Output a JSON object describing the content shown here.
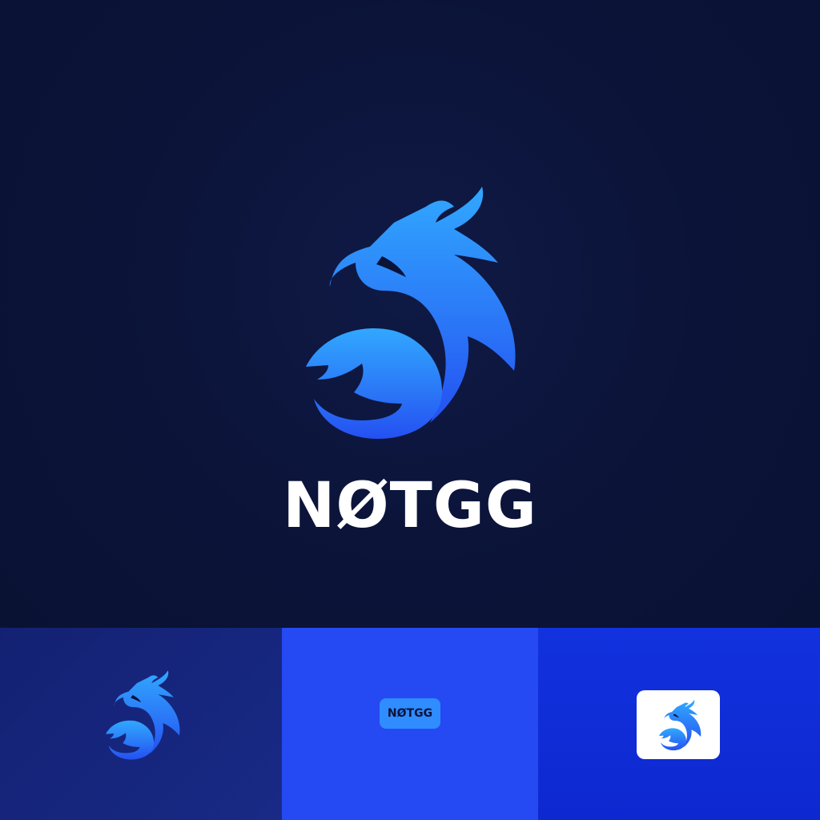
{
  "brand": {
    "wordmark": "NØTGG",
    "small_wordmark": "NØTGG"
  },
  "colors": {
    "background": "#0b1338",
    "mark_gradient_top": "#31a8ff",
    "mark_gradient_bottom": "#2450f2",
    "panel_dark_blue": "#182a86",
    "panel_blue": "#2549f3",
    "panel_deep_blue": "#0d28cf",
    "pill_blue": "#2f8dff",
    "white": "#ffffff"
  },
  "icons": {
    "main_mark": "dragon-icon",
    "small_mark": "dragon-icon",
    "app_icon_mark": "dragon-icon"
  }
}
